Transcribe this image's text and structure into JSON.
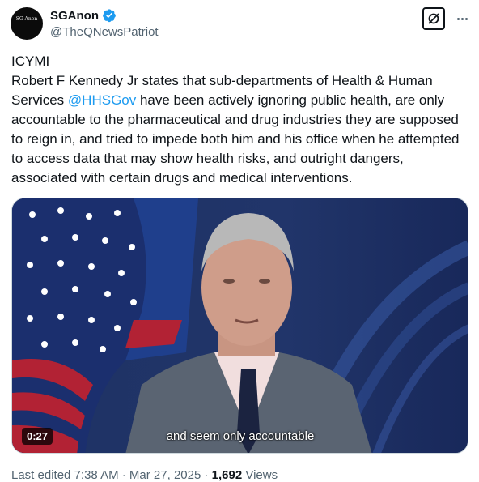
{
  "author": {
    "display_name": "SGAnon",
    "handle": "@TheQNewsPatriot",
    "avatar_text": "SG Anon",
    "verified": true
  },
  "tweet": {
    "line1": "ICYMI",
    "text_before_mention": "Robert F Kennedy Jr states that sub-departments of Health & Human Services ",
    "mention": "@HHSGov",
    "text_after_mention": " have been actively ignoring public health, are only accountable to the pharmaceutical and drug industries they are supposed to reign in, and tried to impede both him and his office when he attempted to access data that may show health risks, and outright dangers, associated with certain drugs and medical interventions."
  },
  "video": {
    "duration": "0:27",
    "caption": "and seem only accountable"
  },
  "meta": {
    "edited": "Last edited 7:38 AM · Mar 27, 2025 · ",
    "views_count": "1,692",
    "views_label": " Views"
  },
  "icons": {
    "verified": "verified-badge-icon",
    "grok": "grok-icon",
    "more": "more-options-icon"
  },
  "colors": {
    "accent": "#1d9bf0",
    "secondary_text": "#536471"
  }
}
